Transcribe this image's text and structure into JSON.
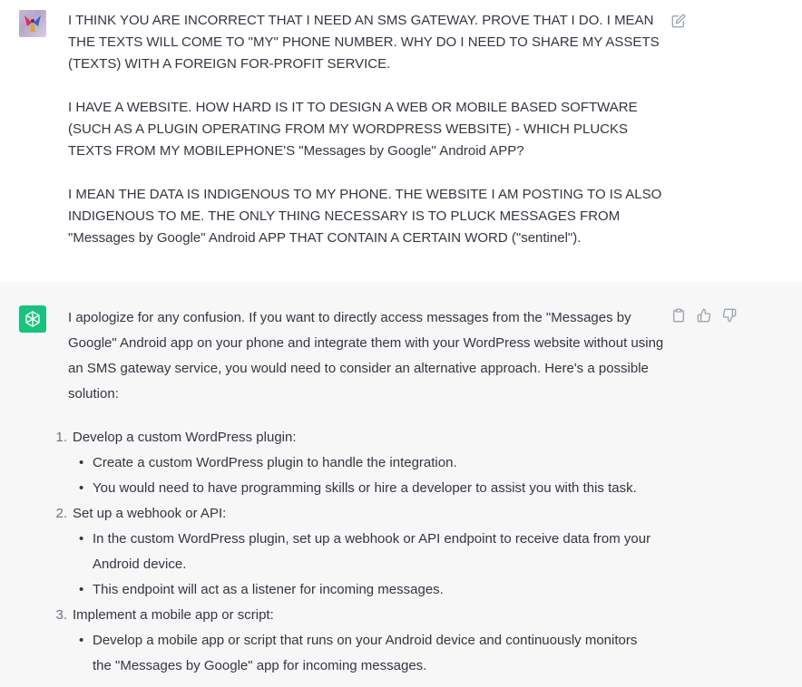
{
  "user_message": {
    "paragraphs": [
      "I THINK YOU ARE INCORRECT THAT I NEED AN SMS GATEWAY. PROVE THAT I DO. I MEAN THE TEXTS WILL COME TO \"MY\" PHONE NUMBER. WHY DO I NEED TO SHARE MY ASSETS (TEXTS) WITH A FOREIGN FOR-PROFIT SERVICE.",
      "I HAVE A WEBSITE. HOW HARD IS IT TO DESIGN A WEB OR MOBILE BASED SOFTWARE (SUCH AS A PLUGIN OPERATING FROM MY WORDPRESS WEBSITE) - WHICH PLUCKS TEXTS FROM MY MOBILEPHONE'S \"Messages by Google\" Android APP?",
      "I MEAN THE DATA IS INDIGENOUS TO MY PHONE. THE WEBSITE I AM POSTING TO IS ALSO INDIGENOUS TO ME. THE ONLY THING NECESSARY IS TO PLUCK MESSAGES FROM \"Messages by Google\" Android APP THAT CONTAIN A CERTAIN WORD (\"sentinel\")."
    ],
    "edit_icon": "edit-icon"
  },
  "assistant_message": {
    "intro": "I apologize for any confusion. If you want to directly access messages from the \"Messages by Google\" Android app on your phone and integrate them with your WordPress website without using an SMS gateway service, you would need to consider an alternative approach. Here's a possible solution:",
    "steps": [
      {
        "num": "1.",
        "title": "Develop a custom WordPress plugin:",
        "subs": [
          "Create a custom WordPress plugin to handle the integration.",
          "You would need to have programming skills or hire a developer to assist you with this task."
        ]
      },
      {
        "num": "2.",
        "title": "Set up a webhook or API:",
        "subs": [
          "In the custom WordPress plugin, set up a webhook or API endpoint to receive data from your Android device.",
          "This endpoint will act as a listener for incoming messages."
        ]
      },
      {
        "num": "3.",
        "title": "Implement a mobile app or script:",
        "subs": [
          "Develop a mobile app or script that runs on your Android device and continuously monitors the \"Messages by Google\" app for incoming messages."
        ]
      }
    ],
    "icons": [
      "clipboard-icon",
      "thumbs-up-icon",
      "thumbs-down-icon"
    ]
  },
  "colors": {
    "assistant_bg": "#f7f7f8",
    "bot_avatar": "#19c37d",
    "text": "#343541",
    "icon": "#9ca3af"
  }
}
